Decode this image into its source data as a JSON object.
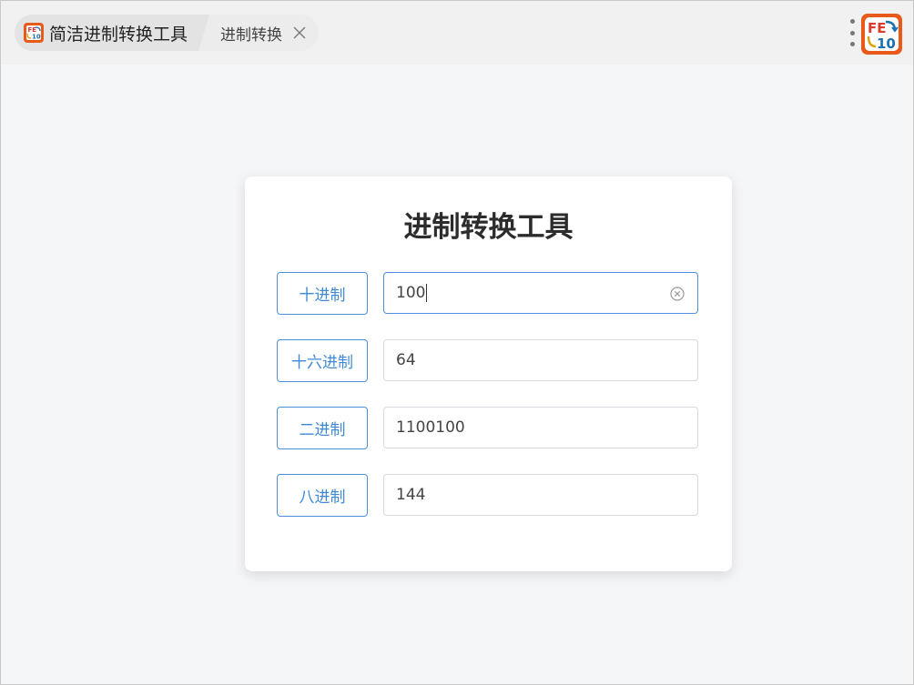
{
  "tabs": {
    "app_label": "简洁进制转换工具",
    "page_label": "进制转换"
  },
  "icons": {
    "app_icon": "fe10-app-icon",
    "close": "close-icon",
    "menu": "more-vertical-icon",
    "clear": "clear-circle-icon"
  },
  "app_icon": {
    "text_top": "FE",
    "text_bottom": "10"
  },
  "card": {
    "title": "进制转换工具"
  },
  "rows": [
    {
      "label": "十进制",
      "value": "100"
    },
    {
      "label": "十六进制",
      "value": "64"
    },
    {
      "label": "二进制",
      "value": "1100100"
    },
    {
      "label": "八进制",
      "value": "144"
    }
  ],
  "colors": {
    "accent": "#3f8ad6",
    "icon_orange": "#e8591a",
    "background": "#f5f6f8"
  }
}
